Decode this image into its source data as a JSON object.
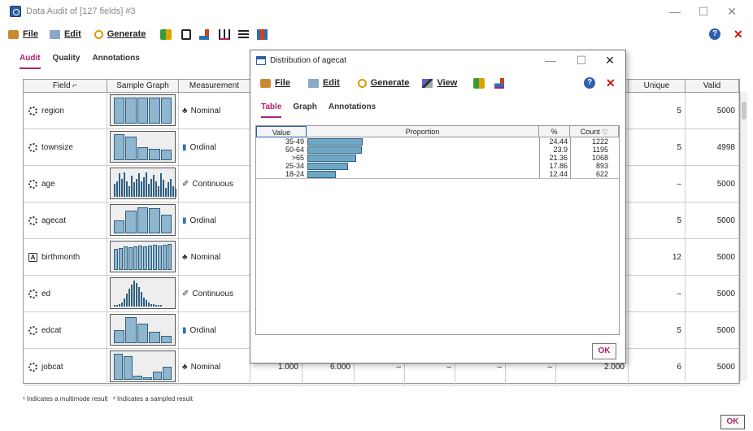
{
  "window": {
    "title": "Data Audit of [127 fields] #3",
    "minimize": "—",
    "maximize": "☐",
    "close": "✕"
  },
  "menu": {
    "file": "File",
    "edit": "Edit",
    "generate": "Generate"
  },
  "tabs": [
    "Audit",
    "Quality",
    "Annotations"
  ],
  "grid": {
    "headers": {
      "field": "Field",
      "sample": "Sample Graph",
      "measurement": "Measurement",
      "unique": "Unique",
      "valid": "Valid"
    },
    "rows": [
      {
        "field": "region",
        "icon": "set-icon",
        "measurement": "Nominal",
        "partial": "00",
        "unique": "5",
        "valid": "5000",
        "bars": [
          1,
          1,
          1,
          1,
          1
        ]
      },
      {
        "field": "townsize",
        "icon": "set-icon",
        "measurement": "Ordinal",
        "partial": "00",
        "unique": "5",
        "valid": "4998",
        "bars": [
          1,
          0.9,
          0.5,
          0.45,
          0.4
        ]
      },
      {
        "field": "age",
        "icon": "set-icon",
        "measurement": "Continuous",
        "partial": "00",
        "unique": "–",
        "valid": "5000",
        "bars": [
          0.5,
          0.6,
          0.9,
          0.7,
          0.95,
          0.6,
          0.4,
          0.8,
          0.55,
          0.7,
          0.9,
          0.6,
          0.75,
          0.95,
          0.5,
          0.7,
          0.85,
          0.6,
          0.4,
          0.9,
          0.65,
          0.35,
          0.55,
          0.7,
          0.4,
          0.3
        ]
      },
      {
        "field": "agecat",
        "icon": "set-icon",
        "measurement": "Ordinal",
        "partial": "00",
        "unique": "5",
        "valid": "5000",
        "bars": [
          0.51,
          0.87,
          1,
          0.98,
          0.73
        ]
      },
      {
        "field": "birthmonth",
        "icon": "string-icon",
        "measurement": "Nominal",
        "partial": "er",
        "unique": "12",
        "valid": "5000",
        "bars": [
          0.8,
          0.85,
          0.9,
          0.88,
          0.92,
          0.95,
          0.9,
          0.93,
          0.97,
          0.95,
          0.98,
          1
        ]
      },
      {
        "field": "ed",
        "icon": "set-icon",
        "measurement": "Continuous",
        "partial": "00",
        "unique": "–",
        "valid": "5000",
        "bars": [
          0.05,
          0.05,
          0.1,
          0.15,
          0.3,
          0.5,
          0.7,
          0.85,
          1,
          0.9,
          0.75,
          0.55,
          0.35,
          0.25,
          0.15,
          0.1,
          0.08,
          0.06,
          0.05,
          0.04
        ]
      },
      {
        "field": "edcat",
        "icon": "set-icon",
        "measurement": "Ordinal",
        "partial": "00",
        "unique": "5",
        "valid": "5000",
        "bars": [
          0.5,
          1,
          0.75,
          0.45,
          0.28
        ]
      },
      {
        "field": "jobcat",
        "icon": "set-icon",
        "measurement": "Nominal",
        "partial": "",
        "min": "1.000",
        "max": "6.000",
        "dash1": "–",
        "dash2": "–",
        "dash3": "–",
        "dash4": "–",
        "mode": "2.000",
        "unique": "6",
        "valid": "5000",
        "bars": [
          1,
          0.9,
          0.15,
          0.1,
          0.3,
          0.5
        ]
      }
    ]
  },
  "footer": {
    "note1": "¹ Indicates a multimode result",
    "note2": "² Indicates a sampled result",
    "ok": "OK"
  },
  "dialog": {
    "title": "Distribution of agecat",
    "minimize": "—",
    "maximize": "☐",
    "close": "✕",
    "menu": {
      "file": "File",
      "edit": "Edit",
      "generate": "Generate",
      "view": "View"
    },
    "tabs": [
      "Table",
      "Graph",
      "Annotations"
    ],
    "table": {
      "headers": {
        "value": "Value",
        "proportion": "Proportion",
        "pct": "%",
        "count": "Count"
      },
      "rows": [
        {
          "value": "35-49",
          "pct": "24.44",
          "count": "1222",
          "frac": 0.2444
        },
        {
          "value": "50-64",
          "pct": "23.9",
          "count": "1195",
          "frac": 0.239
        },
        {
          "value": ">65",
          "pct": "21.36",
          "count": "1068",
          "frac": 0.2136
        },
        {
          "value": "25-34",
          "pct": "17.86",
          "count": "893",
          "frac": 0.1786
        },
        {
          "value": "18-24",
          "pct": "12.44",
          "count": "622",
          "frac": 0.1244
        }
      ]
    },
    "ok": "OK"
  },
  "colors": {
    "accent": "#b0226a",
    "bar": "#6fa8c6",
    "close_red": "#d01010",
    "help_blue": "#2b5fb0"
  }
}
